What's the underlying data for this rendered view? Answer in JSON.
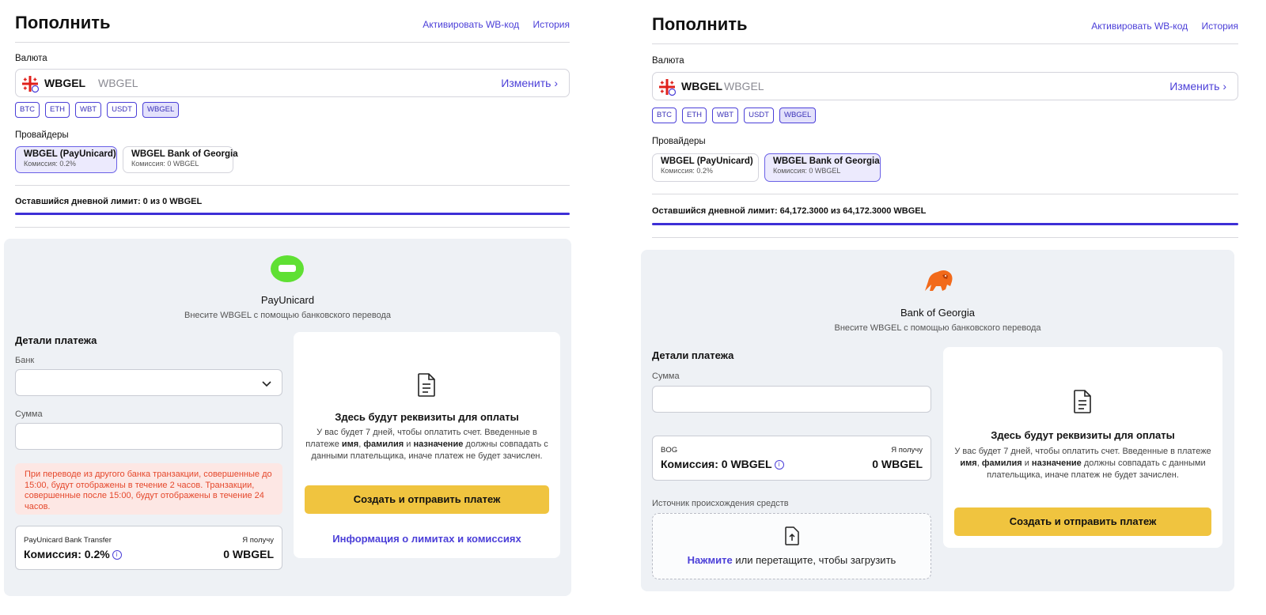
{
  "colors": {
    "accent": "#4b3fd8",
    "button": "#f0c43f",
    "panel_bg": "#eef1f5",
    "warning_bg": "#fde7e4",
    "warning_text": "#e5482c",
    "payunicard_green": "#5fe033",
    "bog_orange": "#f26a1b"
  },
  "left": {
    "title": "Пополнить",
    "activate_link": "Активировать WB-код",
    "history_link": "История",
    "currency_label": "Валюта",
    "currency_name": "WBGEL",
    "currency_sub": "WBGEL",
    "change_label": "Изменить",
    "chips": [
      "BTC",
      "ETH",
      "WBT",
      "USDT",
      "WBGEL"
    ],
    "providers_label": "Провайдеры",
    "providers": [
      {
        "title": "WBGEL (PayUnicard)",
        "fee": "Комиссия: 0.2%"
      },
      {
        "title": "WBGEL Bank of Georgia",
        "fee": "Комиссия: 0 WBGEL"
      }
    ],
    "limit_text": "Оставшийся дневной лимит: 0 из 0 WBGEL",
    "bank_title": "PayUnicard",
    "bank_sub": "Внесите WBGEL с помощью банковского перевода",
    "details_title": "Детали платежа",
    "bank_field_label": "Банк",
    "amount_label": "Сумма",
    "warning": "При переводе из другого банка транзакции, совершенные до 15:00, будут отображены в течение 2 часов. Транзакции, совершенные после 15:00, будут отображены в течение 24 часов.",
    "fee_box": {
      "method": "PayUnicard Bank Transfer",
      "fee": "Комиссия: 0.2%",
      "receive_label": "Я получу",
      "receive_value": "0 WBGEL"
    },
    "card": {
      "title": "Здесь будут реквизиты для оплаты",
      "text_1": "У вас будет 7 дней, чтобы оплатить счет. Введенные в платеже",
      "bold_1": "имя",
      "sep_1": ",",
      "bold_2": "фамилия",
      "sep_2": "и",
      "bold_3": "назначение",
      "text_2": "должны совпадать с данными плательщика, иначе платеж не будет зачислен.",
      "button": "Создать и отправить платеж",
      "limits_link": "Информация о лимитах и комиссиях"
    }
  },
  "right": {
    "title": "Пополнить",
    "activate_link": "Активировать WB-код",
    "history_link": "История",
    "currency_label": "Валюта",
    "currency_name": "WBGEL",
    "currency_sub": "WBGEL",
    "change_label": "Изменить",
    "chips": [
      "BTC",
      "ETH",
      "WBT",
      "USDT",
      "WBGEL"
    ],
    "providers_label": "Провайдеры",
    "providers": [
      {
        "title": "WBGEL (PayUnicard)",
        "fee": "Комиссия: 0.2%"
      },
      {
        "title": "WBGEL Bank of Georgia",
        "fee": "Комиссия: 0 WBGEL"
      }
    ],
    "limit_text": "Оставшийся дневной лимит: 64,172.3000 из 64,172.3000 WBGEL",
    "bank_title": "Bank of Georgia",
    "bank_sub": "Внесите WBGEL с помощью банковского перевода",
    "details_title": "Детали платежа",
    "amount_label": "Сумма",
    "fee_box": {
      "method": "BOG",
      "fee": "Комиссия: 0 WBGEL",
      "receive_label": "Я получу",
      "receive_value": "0 WBGEL"
    },
    "source_label": "Источник происхождения средств",
    "upload_link": "Нажмите",
    "upload_text": "или перетащите, чтобы загрузить",
    "card": {
      "title": "Здесь будут реквизиты для оплаты",
      "text_1": "У вас будет 7 дней, чтобы оплатить счет. Введенные в платеже",
      "bold_1": "имя",
      "sep_1": ",",
      "bold_2": "фамилия",
      "sep_2": "и",
      "bold_3": "назначение",
      "text_2": "должны совпадать с данными плательщика, иначе платеж не будет зачислен.",
      "button": "Создать и отправить платеж"
    }
  }
}
